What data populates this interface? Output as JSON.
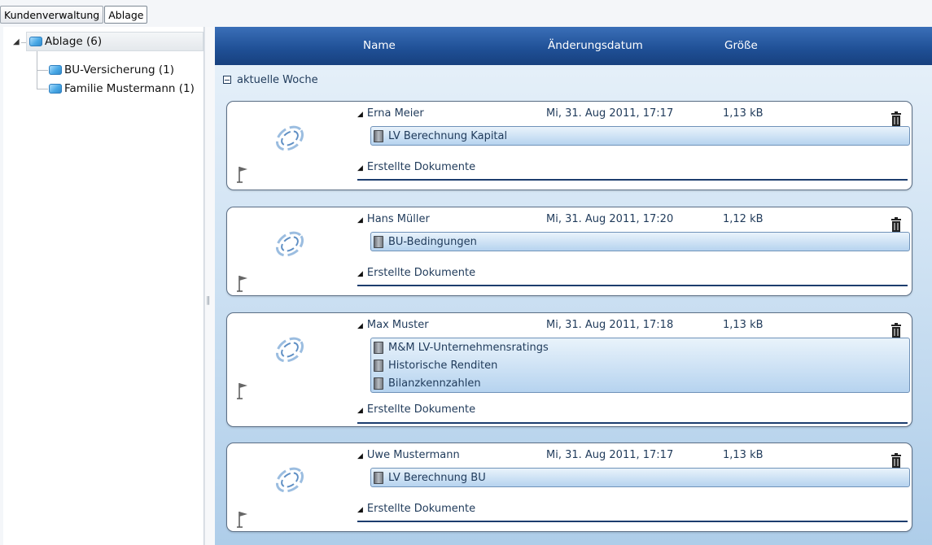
{
  "tabs": [
    "Kundenverwaltung",
    "Ablage"
  ],
  "tree": {
    "root": "Ablage (6)",
    "children": [
      "BU-Versicherung (1)",
      "Familie Mustermann (1)"
    ]
  },
  "columns": {
    "name": "Name",
    "date": "Änderungsdatum",
    "size": "Größe"
  },
  "group": {
    "label": "aktuelle Woche"
  },
  "created_label": "Erstellte Dokumente",
  "cards": [
    {
      "person": "Erna Meier",
      "date": "Mi, 31. Aug 2011, 17:17",
      "size": "1,13 kB",
      "documents": [
        "LV Berechnung Kapital"
      ]
    },
    {
      "person": "Hans Müller",
      "date": "Mi, 31. Aug 2011, 17:20",
      "size": "1,12 kB",
      "documents": [
        "BU-Bedingungen"
      ]
    },
    {
      "person": "Max Muster",
      "date": "Mi, 31. Aug 2011, 17:18",
      "size": "1,13 kB",
      "documents": [
        "M&M LV-Unternehmensratings",
        "Historische Renditen",
        "Bilanzkennzahlen"
      ]
    },
    {
      "person": "Uwe Mustermann",
      "date": "Mi, 31. Aug 2011, 17:17",
      "size": "1,13 kB",
      "documents": [
        "LV Berechnung BU"
      ]
    }
  ],
  "colors": {
    "header": "#1f4f95",
    "accent": "#1c3d6e",
    "folder": "#4aa9e6"
  }
}
